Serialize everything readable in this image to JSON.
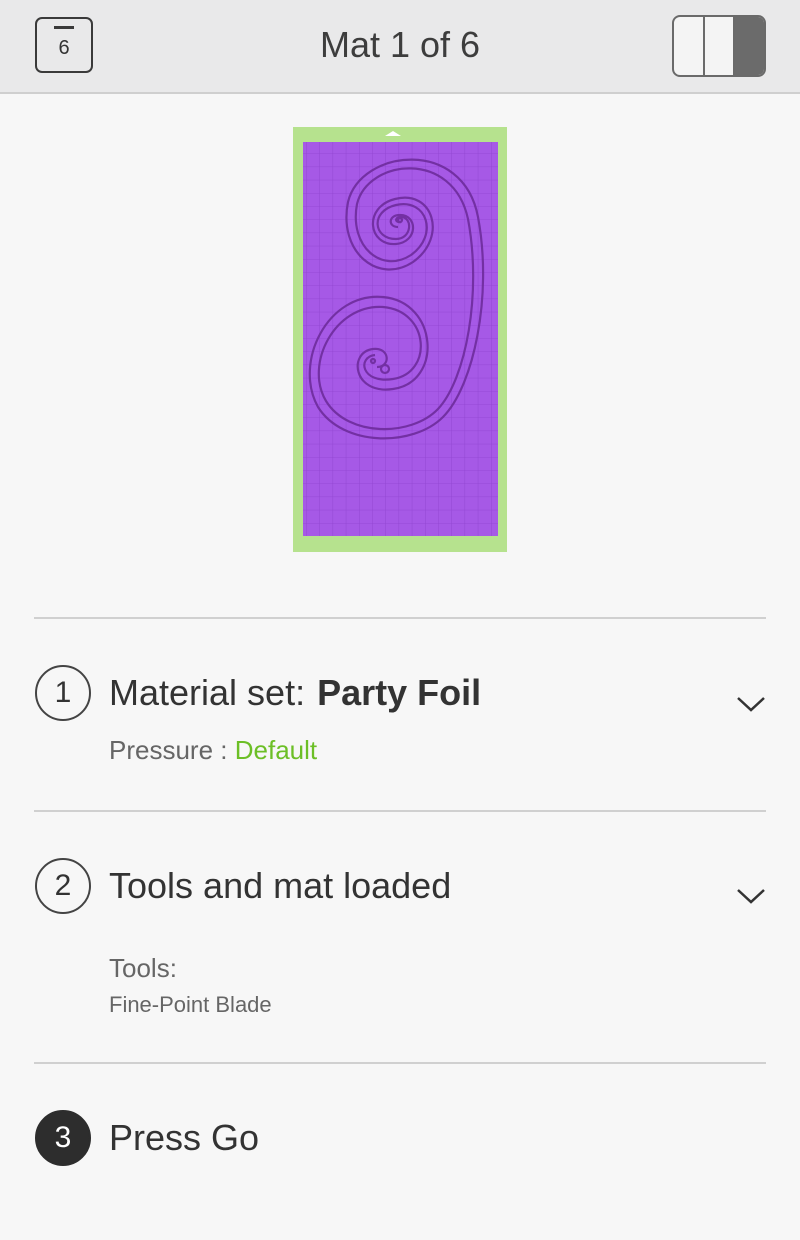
{
  "header": {
    "mat_count": "6",
    "title": "Mat 1 of 6"
  },
  "steps": [
    {
      "number": "1",
      "title": "Material set:",
      "material": "Party Foil",
      "pressure_label": "Pressure :",
      "pressure_value": "Default"
    },
    {
      "number": "2",
      "title": "Tools and mat loaded",
      "tools_label": "Tools:",
      "tools_value": "Fine-Point Blade"
    },
    {
      "number": "3",
      "title": "Press Go"
    }
  ],
  "colors": {
    "mat_frame": "#b6e28e",
    "material": "#a659e6",
    "accent_green": "#6cbf26",
    "step3_fill": "#2d2d2d"
  },
  "icons": {
    "mat_count": "mat-stack-icon",
    "view_toggle": "split-view-icon",
    "expand": "chevron-down-icon"
  }
}
